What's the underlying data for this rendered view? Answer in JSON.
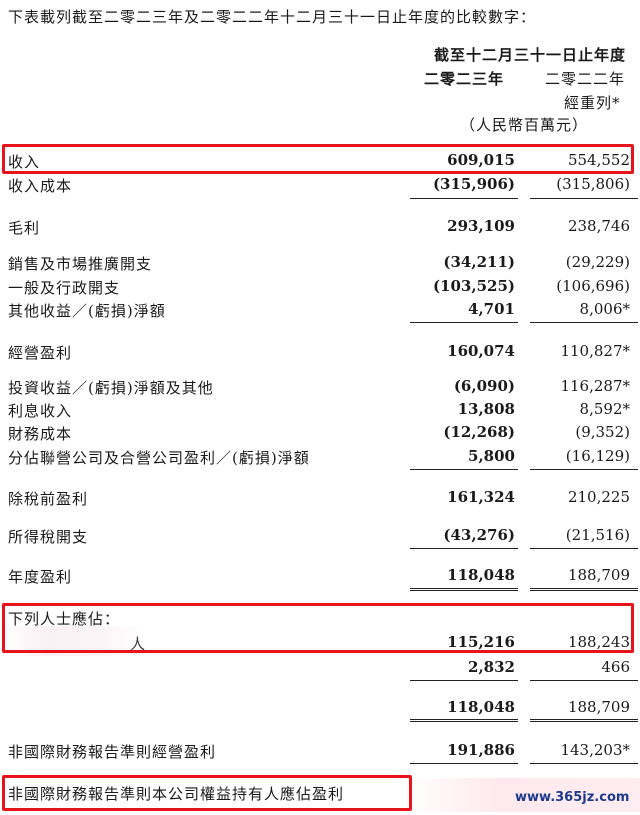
{
  "intro": "下表載列截至二零二三年及二零二二年十二月三十一日止年度的比較數字：",
  "header": {
    "period": "截至十二月三十一日止年度",
    "col_2023": "二零二三年",
    "col_2022": "二零二二年",
    "restated": "經重列*",
    "unit": "（人民幣百萬元）"
  },
  "rows": [
    {
      "label": "收入",
      "v2023": "609,015",
      "v2022": "554,552"
    },
    {
      "label": "收入成本",
      "v2023": "(315,906)",
      "v2022": "(315,806)"
    },
    {
      "label": "毛利",
      "v2023": "293,109",
      "v2022": "238,746"
    },
    {
      "label": "銷售及市場推廣開支",
      "v2023": "(34,211)",
      "v2022": "(29,229)"
    },
    {
      "label": "一般及行政開支",
      "v2023": "(103,525)",
      "v2022": "(106,696)"
    },
    {
      "label": "其他收益／(虧損)淨額",
      "v2023": "4,701",
      "v2022": "8,006*"
    },
    {
      "label": "經營盈利",
      "v2023": "160,074",
      "v2022": "110,827*"
    },
    {
      "label": "投資收益／(虧損)淨額及其他",
      "v2023": "(6,090)",
      "v2022": "116,287*"
    },
    {
      "label": "利息收入",
      "v2023": "13,808",
      "v2022": "8,592*"
    },
    {
      "label": "財務成本",
      "v2023": "(12,268)",
      "v2022": "(9,352)"
    },
    {
      "label": "分佔聯營公司及合營公司盈利／(虧損)淨額",
      "v2023": "5,800",
      "v2022": "(16,129)"
    },
    {
      "label": "除稅前盈利",
      "v2023": "161,324",
      "v2022": "210,225"
    },
    {
      "label": "所得稅開支",
      "v2023": "(43,276)",
      "v2022": "(21,516)"
    },
    {
      "label": "年度盈利",
      "v2023": "118,048",
      "v2022": "188,709"
    },
    {
      "label": "下列人士應佔：",
      "v2023": "",
      "v2022": ""
    },
    {
      "label": "人",
      "v2023": "115,216",
      "v2022": "188,243"
    },
    {
      "label": "",
      "v2023": "2,832",
      "v2022": "466"
    },
    {
      "label": "",
      "v2023": "118,048",
      "v2022": "188,709"
    },
    {
      "label": "非國際財務報告準則經營盈利",
      "v2023": "191,886",
      "v2022": "143,203*"
    },
    {
      "label": "非國際財務報告準則本公司權益持有人應佔盈利",
      "v2023": "",
      "v2022": ""
    }
  ],
  "watermark": "www.365jz.com",
  "colors": {
    "highlight": "#e8141c",
    "watermark": "#1b3a8c"
  }
}
